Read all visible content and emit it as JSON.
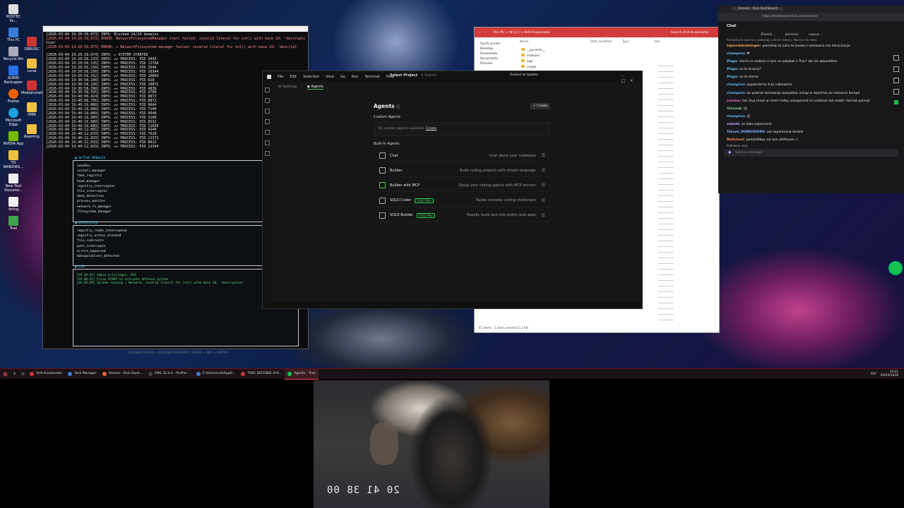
{
  "desktop": {
    "icons": [
      {
        "label": "ROSTEC Fe..."
      },
      {
        "label": "This PC"
      },
      {
        "label": "Recycle Bin"
      },
      {
        "label": "AOMEI Backupper"
      },
      {
        "label": "Firefox"
      },
      {
        "label": "Microsoft Edge"
      },
      {
        "label": "NVIDIA App"
      },
      {
        "label": "TO RAINOW1..."
      },
      {
        "label": "New Text Docume..."
      },
      {
        "label": "string"
      },
      {
        "label": "Tree"
      }
    ],
    "icons2": [
      {
        "label": "OBRUSC"
      },
      {
        "label": "Local"
      },
      {
        "label": "MediaInstaller"
      },
      {
        "label": "OMR"
      },
      {
        "label": "Roaming"
      }
    ]
  },
  "console": {
    "log": [
      "[2026-03-04 19:20:39,073] INFO: Blocked 24/24 domains",
      "[2026-03-04 19:20:39,073] ERROR: NetworkFilesystemManager start failed: invalid literal for int() with base 10: 'descripti",
      "tion'",
      "[2026-03-04 19:20:39,073] ERROR: ✔ NetworkFilesystem manager failed: invalid literal for int() with base 10: 'descript",
      "",
      "[2026-03-04 19:20:39,074] INFO: ✔ SYSTEM STARTED",
      "[2026-03-04 19:20:56,133] INFO: ✔✔ PROCESS: PID 9443",
      "[2026-03-04 19:20:56,135] INFO: ✔✔ PROCESS: PID 11768",
      "[2026-03-04 19:20:56,150] INFO: ✔✔ PROCESS: PID 3340",
      "[2026-03-04 19:20:56,150] INFO: ✔✔ PROCESS: PID 10344",
      "[2026-03-04 19:20:56,162] INFO: ✔✔ PROCESS: PID 10864",
      "[2026-03-04 19:30:58,100] INFO: ✔✔ PROCESS: PID 628",
      "[2026-03-04 19:30:58,100] INFO: ✔✔ PROCESS: PID 10872",
      "[2026-03-04 19:30:58,390] INFO: ✔✔ PROCESS: PID 4836",
      "[2026-03-04 19:30:58,591] INFO: ✔✔ PROCESS: PID 3700",
      "[2026-03-04 19:40:00,424] INFO: ✔✔ PROCESS: PID 8873",
      "[2026-03-04 19:40:08,795] INFO: ✔✔ PROCESS: PID 8872",
      "[2026-03-04 19:40:10,080] INFO: ✔✔ PROCESS: PID 9644",
      "[2026-03-04 19:40:10,080] INFO: ✔✔ PROCESS: PID 7104",
      "[2026-03-04 19:40:10,089] INFO: ✔✔ PROCESS: PID 9948",
      "[2026-03-04 19:40:10,089] INFO: ✔✔ PROCESS: PID 3100",
      "[2026-03-04 19:40:10,089] INFO: ✔✔ PROCESS: PID 8532",
      "[2026-03-04 19:40:10,089] INFO: ✔✔ PROCESS: PID 11030",
      "[2026-03-04 19:40:12,001] INFO: ✔✔ PROCESS: PID 4240",
      "[2026-03-04 19:40:12,033] INFO: ✔✔ PROCESS: PID 7628",
      "[2026-03-04 19:40:12,033] INFO: ✔✔ PROCESS: PID 11372",
      "[2026-03-04 19:40:12,033] INFO: ✔✔ PROCESS: PID 8012",
      "[2026-03-04 19:40:12,033] INFO: ✔✔ PROCESS: PID 12344"
    ],
    "modules_header": "▣ ACTIVE MODULES",
    "modules": [
      "sandbox",
      "install_manager",
      "fake_registry",
      "hook_manager",
      "registry_interceptor",
      "file_interceptor",
      "deep_detection",
      "process_monitor",
      "network_fs_manager",
      "filesystem_manager"
    ],
    "stats_header": "▣ STATISTICS",
    "stats": [
      "registry_reads_intercepted",
      "registry_writes_blocked",
      "file_redirects",
      "path_intercepts",
      "errors_bypassed",
      "manipulations_detected"
    ],
    "log_header": "▣ LOG",
    "log_lines": [
      "[19:20:35] Admin privileges: YES",
      "[19:20:35] Click START to activate defense system",
      "[19:20:39] System running | Network: invalid literal for int() with base 10: 'description'"
    ],
    "footer": "GCOLDER ISLACS + GCOLDER PROGGER | ANTIDA + SKIL + INSTRA"
  },
  "editor": {
    "menu": [
      "File",
      "Edit",
      "Selection",
      "View",
      "Go",
      "Run",
      "Terminal",
      "Help"
    ],
    "project": "Select Project",
    "search": "Search",
    "restart": "Restart to Update",
    "tabs": [
      "Settings",
      "Agents"
    ],
    "page_title": "Agents",
    "create_button": "+ Create",
    "custom_header": "Custom Agents",
    "no_custom": "No custom agents available.",
    "create_link": "Create",
    "builtin_header": "Built-In Agents",
    "agents": [
      {
        "name": "Chat",
        "desc": "Chat about your codebase",
        "tag": ""
      },
      {
        "name": "Builder",
        "desc": "Build coding projects with simple language",
        "tag": ""
      },
      {
        "name": "Builder with MCP",
        "desc": "Equip your coding agents with MCP servers",
        "tag": ""
      },
      {
        "name": "SOLO Coder",
        "desc": "Tackle complex coding challenges",
        "tag": "SOLO Max"
      },
      {
        "name": "SOLO Builder",
        "desc": "Rapidly build and ship pretty web apps",
        "tag": "SOLO Max"
      }
    ]
  },
  "explorer": {
    "address": "This PC > W (C:) > Drill Kvazonator",
    "search": "Search Drill-Kvazonator",
    "nav": [
      "Quick access",
      "Desktop",
      "Downloads",
      "Documents",
      "Pictures"
    ],
    "columns": [
      "Name",
      "Date modified",
      "Type",
      "Size"
    ],
    "files": [
      "__pycache__",
      "modules",
      "logs",
      "crypto"
    ],
    "status": "41 items",
    "selected": "1 item selected 2,2 KB"
  },
  "chat": {
    "tab": "Stream - Kick Dashboard",
    "url": "https://dashboard.kick.com/stream",
    "title": "Chat",
    "pinned": [
      "Zlomila...",
      "pansoski",
      "sapcus..."
    ],
    "reply": "Replying to sponsor_patologi_e Brain dolary, Narcon da zlota",
    "messages": [
      {
        "user": "tajzoraldzsteinger:",
        "text": "pamietaj ze jutro ta kurwa z sosnowca ma ekranizacje",
        "color": "#ffb347"
      },
      {
        "user": "champion:",
        "text": "❤",
        "color": "#5bc0ff"
      },
      {
        "user": "Plaga:",
        "text": "sierra co sadzisz o tym co odjebali z Trac? ale sie wkurwilem",
        "color": "#5bc0ff"
      },
      {
        "user": "Plaga:",
        "text": "co to znaczy?",
        "color": "#5bc0ff"
      },
      {
        "user": "Plaga:",
        "text": "no to teznie",
        "color": "#5bc0ff"
      },
      {
        "user": "champion:",
        "text": "wyplerdol to tras calkowicie",
        "color": "#5bc0ff"
      },
      {
        "user": "champion:",
        "text": "on pewnie wznawiajs wszystkie uslugi w rejestrze po restarcie kompa",
        "color": "#5bc0ff"
      },
      {
        "user": "(vormo:",
        "text": "ten chuj moze w rarnir linkty nasuponcid mi ostatnio tak zrobil i format policial",
        "color": "#ff6bd5"
      },
      {
        "user": "Glenzuk:",
        "text": "☺",
        "color": "#7fd47f"
      },
      {
        "user": "champion:",
        "text": "☺",
        "color": "#5bc0ff"
      },
      {
        "user": "sobuhl:",
        "text": "co data zsponcone",
        "color": "#c39bff"
      },
      {
        "user": "Taksmi_DOBRODORR:",
        "text": "ale sapomcene bedzie",
        "color": "#7fb0ff"
      },
      {
        "user": "Melichesi:",
        "text": "podzieliłbys sie tym defensen :)",
        "color": "#ff8c5a"
      }
    ],
    "followers": "Followers only",
    "input_placeholder": "Send a message"
  },
  "taskbar": {
    "items": [
      {
        "label": "Drill-Kvazonator",
        "active": false
      },
      {
        "label": "Task Manager",
        "active": false
      },
      {
        "label": "Stream - Kick Dash...",
        "active": false
      },
      {
        "label": "OBS 32.0.4 - Profile:...",
        "active": false
      },
      {
        "label": "C:\\Users\\rad\\AppD...",
        "active": false
      },
      {
        "label": "TRAE DEFENSE SYS...",
        "active": false
      },
      {
        "label": "Agents - Trae",
        "active": true
      }
    ],
    "lang": "PLP",
    "time": "19:41",
    "date": "04/03/2026"
  },
  "webcam": {
    "timecode": "20 41 38 00"
  },
  "colors": {
    "accent_green": "#19c24a",
    "taskbar_bg": "#1b1116",
    "console_bg": "#0d0d10",
    "editor_bg": "#161616",
    "chat_bg": "#18181b"
  }
}
